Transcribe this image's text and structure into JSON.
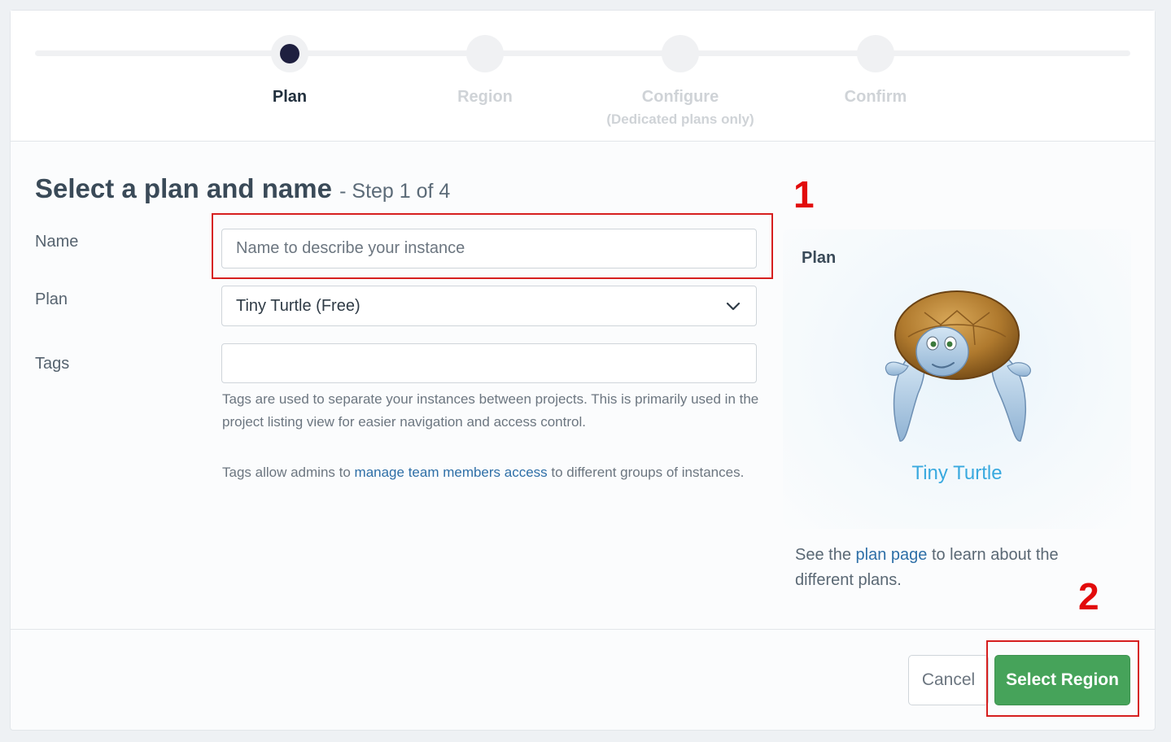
{
  "stepper": {
    "steps": [
      {
        "label": "Plan",
        "sub": "",
        "active": true
      },
      {
        "label": "Region",
        "sub": "",
        "active": false
      },
      {
        "label": "Configure",
        "sub": "(Dedicated plans only)",
        "active": false
      },
      {
        "label": "Confirm",
        "sub": "",
        "active": false
      }
    ]
  },
  "form": {
    "heading": "Select a plan and name",
    "step_indicator": "- Step 1 of 4",
    "name_label": "Name",
    "name_placeholder": "Name to describe your instance",
    "name_value": "",
    "plan_label": "Plan",
    "plan_selected": "Tiny Turtle (Free)",
    "tags_label": "Tags",
    "tags_value": "",
    "tags_help_1": "Tags are used to separate your instances between projects. This is primarily used in the project listing view for easier navigation and access control.",
    "tags_help_2_before": "Tags allow admins to ",
    "tags_help_2_link": "manage team members access",
    "tags_help_2_after": " to different groups of instances."
  },
  "plan_panel": {
    "title": "Plan",
    "plan_name": "Tiny Turtle",
    "note_before": "See the ",
    "note_link": "plan page",
    "note_after": " to learn about the different plans."
  },
  "annotations": {
    "marker_1": "1",
    "marker_2": "2",
    "color": "#d61f1f"
  },
  "footer": {
    "cancel_label": "Cancel",
    "primary_label": "Select Region",
    "primary_color": "#46a35a"
  }
}
